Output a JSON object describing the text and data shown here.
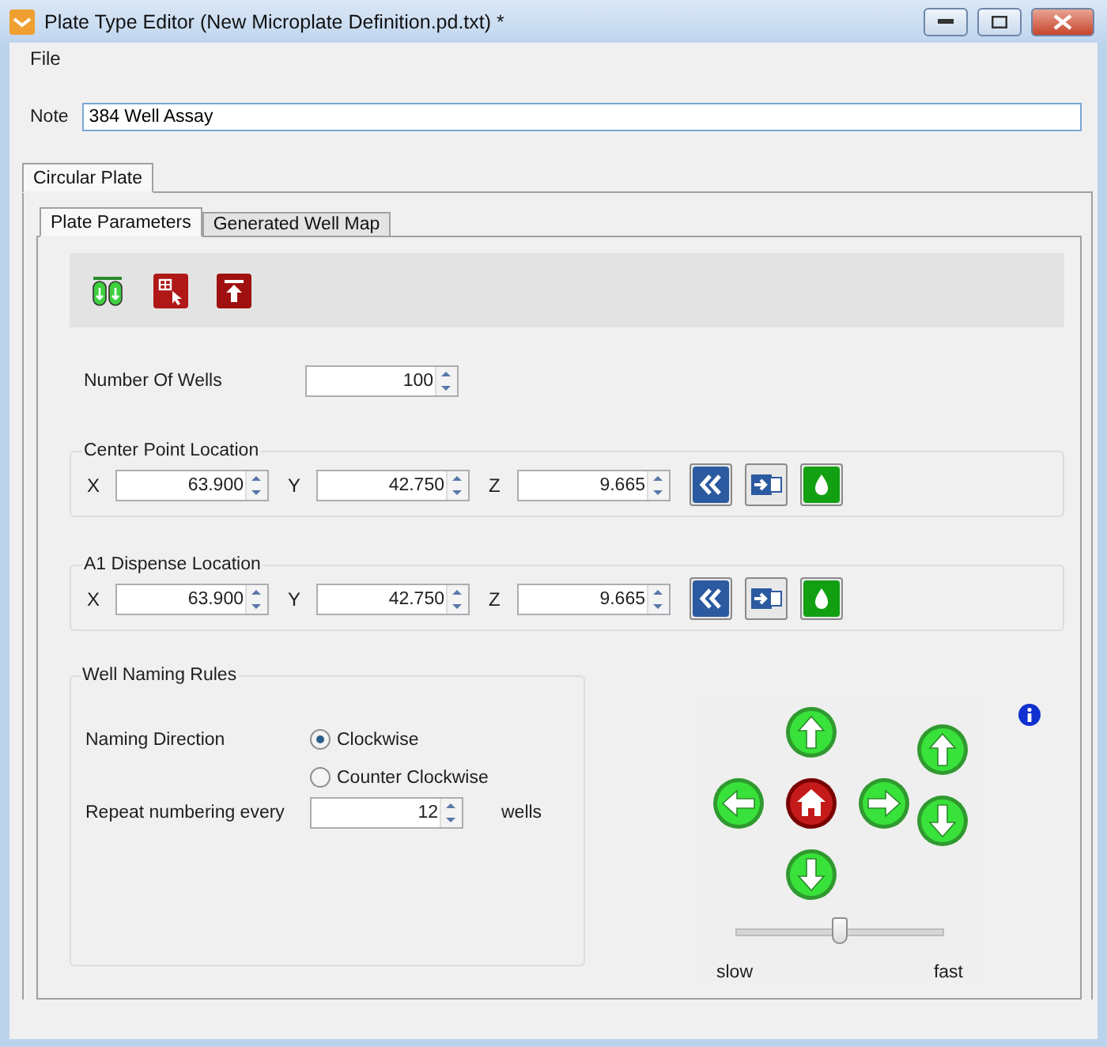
{
  "window": {
    "title": "Plate Type Editor (New Microplate Definition.pd.txt) *"
  },
  "menu": [
    {
      "label": "File"
    }
  ],
  "note": {
    "label": "Note",
    "value": "384 Well Assay"
  },
  "outer_tabs": [
    {
      "label": "Circular Plate",
      "selected": true
    }
  ],
  "inner_tabs": [
    {
      "label": "Plate Parameters",
      "selected": true
    },
    {
      "label": "Generated Well Map",
      "selected": false
    }
  ],
  "number_of_wells": {
    "label": "Number Of Wells",
    "value": "100"
  },
  "locations": [
    {
      "title": "Center Point Location",
      "fields": [
        {
          "axis": "X",
          "value": "63.900"
        },
        {
          "axis": "Y",
          "value": "42.750"
        },
        {
          "axis": "Z",
          "value": "9.665"
        }
      ]
    },
    {
      "title": "A1 Dispense Location",
      "fields": [
        {
          "axis": "X",
          "value": "63.900"
        },
        {
          "axis": "Y",
          "value": "42.750"
        },
        {
          "axis": "Z",
          "value": "9.665"
        }
      ]
    }
  ],
  "naming": {
    "title": "Well Naming Rules",
    "direction_label": "Naming Direction",
    "options": [
      {
        "label": "Clockwise",
        "selected": true
      },
      {
        "label": "Counter Clockwise",
        "selected": false
      }
    ],
    "repeat_label": "Repeat numbering every",
    "repeat_value": "12",
    "repeat_unit": "wells"
  },
  "speed": {
    "level": 0.5,
    "min_label": "slow",
    "max_label": "fast"
  }
}
